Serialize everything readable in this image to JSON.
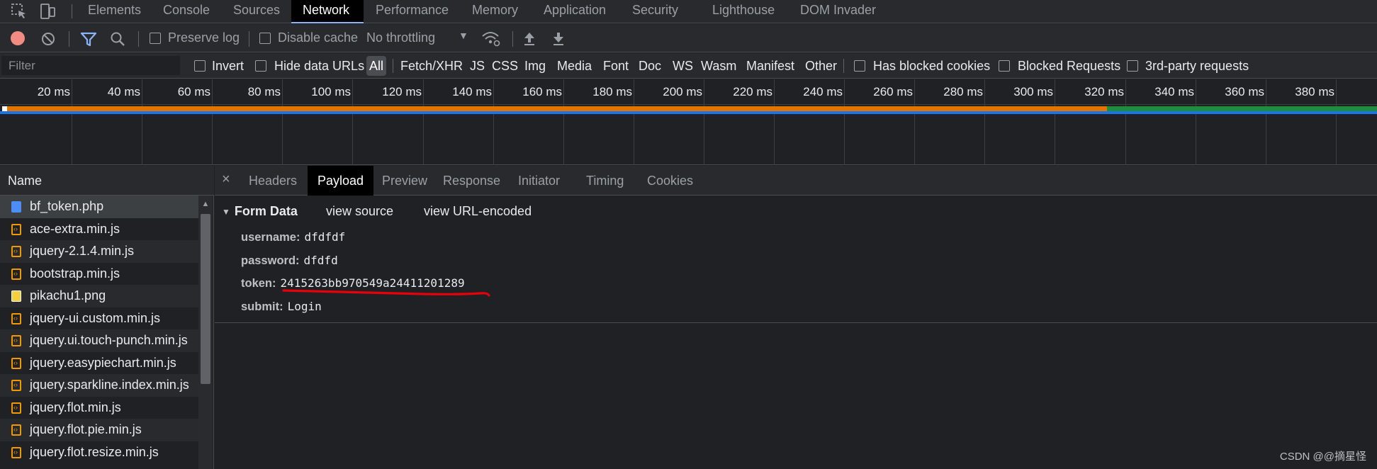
{
  "tabs": [
    "Elements",
    "Console",
    "Sources",
    "Network",
    "Performance",
    "Memory",
    "Application",
    "Security",
    "Lighthouse",
    "DOM Invader"
  ],
  "active_tab": "Network",
  "toolbar": {
    "preserve_log": "Preserve log",
    "disable_cache": "Disable cache",
    "throttling": "No throttling"
  },
  "filterbar": {
    "placeholder": "Filter",
    "invert": "Invert",
    "hide_data_urls": "Hide data URLs",
    "types": [
      "All",
      "Fetch/XHR",
      "JS",
      "CSS",
      "Img",
      "Media",
      "Font",
      "Doc",
      "WS",
      "Wasm",
      "Manifest",
      "Other"
    ],
    "has_blocked_cookies": "Has blocked cookies",
    "blocked_requests": "Blocked Requests",
    "third_party": "3rd-party requests"
  },
  "timeline": {
    "ticks": [
      "20 ms",
      "40 ms",
      "60 ms",
      "80 ms",
      "100 ms",
      "120 ms",
      "140 ms",
      "160 ms",
      "180 ms",
      "200 ms",
      "220 ms",
      "240 ms",
      "260 ms",
      "280 ms",
      "300 ms",
      "320 ms",
      "340 ms",
      "360 ms",
      "380 ms",
      "40"
    ]
  },
  "name_panel": {
    "header": "Name",
    "files": [
      {
        "name": "bf_token.php",
        "type": "doc"
      },
      {
        "name": "ace-extra.min.js",
        "type": "js"
      },
      {
        "name": "jquery-2.1.4.min.js",
        "type": "js"
      },
      {
        "name": "bootstrap.min.js",
        "type": "js"
      },
      {
        "name": "pikachu1.png",
        "type": "img"
      },
      {
        "name": "jquery-ui.custom.min.js",
        "type": "js"
      },
      {
        "name": "jquery.ui.touch-punch.min.js",
        "type": "js"
      },
      {
        "name": "jquery.easypiechart.min.js",
        "type": "js"
      },
      {
        "name": "jquery.sparkline.index.min.js",
        "type": "js"
      },
      {
        "name": "jquery.flot.min.js",
        "type": "js"
      },
      {
        "name": "jquery.flot.pie.min.js",
        "type": "js"
      },
      {
        "name": "jquery.flot.resize.min.js",
        "type": "js"
      }
    ]
  },
  "detail": {
    "close": "×",
    "tabs": [
      "Headers",
      "Payload",
      "Preview",
      "Response",
      "Initiator",
      "Timing",
      "Cookies"
    ],
    "active_tab": "Payload",
    "form_data_title": "Form Data",
    "view_source": "view source",
    "view_url_encoded": "view URL-encoded",
    "fields": [
      {
        "key": "username:",
        "value": "dfdfdf"
      },
      {
        "key": "password:",
        "value": "dfdfd"
      },
      {
        "key": "token:",
        "value": "2415263bb970549a24411201289"
      },
      {
        "key": "submit:",
        "value": "Login"
      }
    ]
  },
  "watermark": "CSDN @@摘星怪",
  "colors": {
    "accent": "#8ab4f8",
    "record": "#f28b82",
    "orange_bar": "#e37400",
    "green_bar": "#1e8e3e",
    "annotation_red": "#e8000b"
  }
}
